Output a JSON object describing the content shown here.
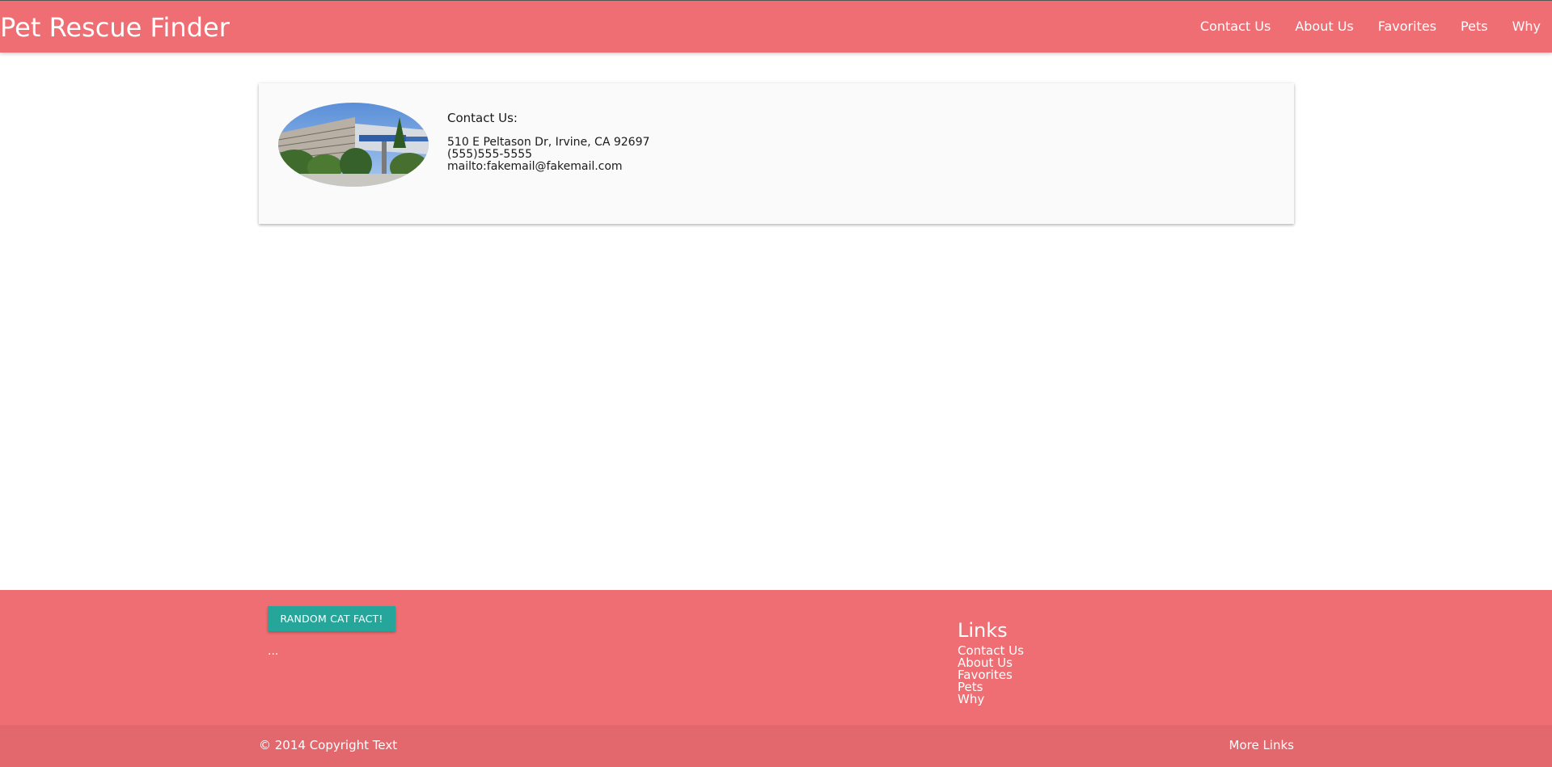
{
  "navbar": {
    "brand": "Pet Rescue Finder",
    "links": [
      {
        "label": "Contact Us"
      },
      {
        "label": "About Us"
      },
      {
        "label": "Favorites"
      },
      {
        "label": "Pets"
      },
      {
        "label": "Why"
      }
    ]
  },
  "contact_card": {
    "heading": "Contact Us:",
    "address": "510 E Peltason Dr, Irvine, CA 92697",
    "phone": "(555)555-5555",
    "email": "mailto:fakemail@fakemail.com"
  },
  "footer": {
    "button_label": "RANDOM CAT FACT!",
    "fact_text": "...",
    "links_heading": "Links",
    "links": [
      {
        "label": "Contact Us"
      },
      {
        "label": "About Us"
      },
      {
        "label": "Favorites"
      },
      {
        "label": "Pets"
      },
      {
        "label": "Why"
      }
    ],
    "copyright": "© 2014 Copyright Text",
    "more_links": "More Links"
  },
  "colors": {
    "primary": "#ef6e73",
    "footer_bottom": "#e2686d",
    "button": "#26a69a"
  }
}
